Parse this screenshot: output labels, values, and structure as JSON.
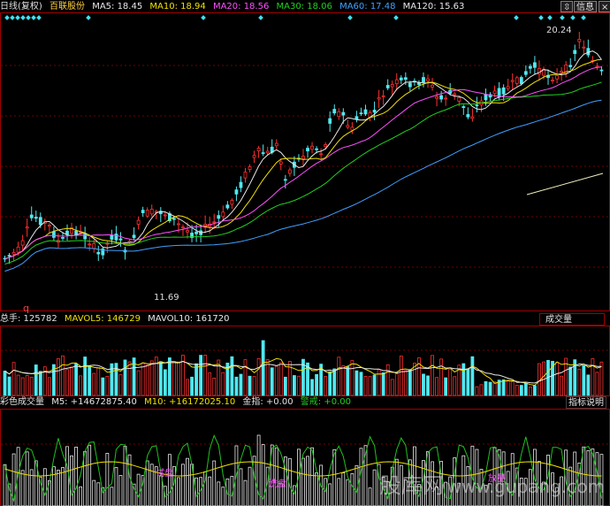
{
  "header": {
    "period": "日线(复权)",
    "stock": "百联股份",
    "ma": [
      {
        "label": "MA5: 18.45",
        "color": "#e8e8e8"
      },
      {
        "label": "MA10: 18.94",
        "color": "#f0e000"
      },
      {
        "label": "MA20: 18.56",
        "color": "#ff50ff"
      },
      {
        "label": "MA30: 18.06",
        "color": "#20d020"
      },
      {
        "label": "MA60: 17.48",
        "color": "#40a0ff"
      },
      {
        "label": "MA120: 15.63",
        "color": "#e8e8e8"
      }
    ]
  },
  "toolbar": {
    "icon_label": "⇳",
    "info_label": "信息",
    "close_label": "×"
  },
  "price_pane": {
    "high_label": "20.24",
    "low_label": "11.69",
    "q_marker": "q"
  },
  "volume_pane": {
    "title": "总手: 125782",
    "mavol5": "MAVOL5: 146729",
    "mavol10": "MAVOL10: 161720",
    "button_label": "成交量",
    "colors": {
      "up": "#ff3030",
      "down": "#50e8f0"
    }
  },
  "color_pane": {
    "title": "彩色成交量",
    "m5": "M5: +14672875.40",
    "m10": "M10: +16172025.10",
    "jinzhi": "金指: +0.00",
    "fangyu": "警戒: +0.00",
    "button_label": "指标说明",
    "labels": [
      "试盘",
      "洗盘",
      "放量"
    ]
  },
  "watermark": {
    "chinese": "股库网",
    "url": "www.gupang.com"
  }
}
